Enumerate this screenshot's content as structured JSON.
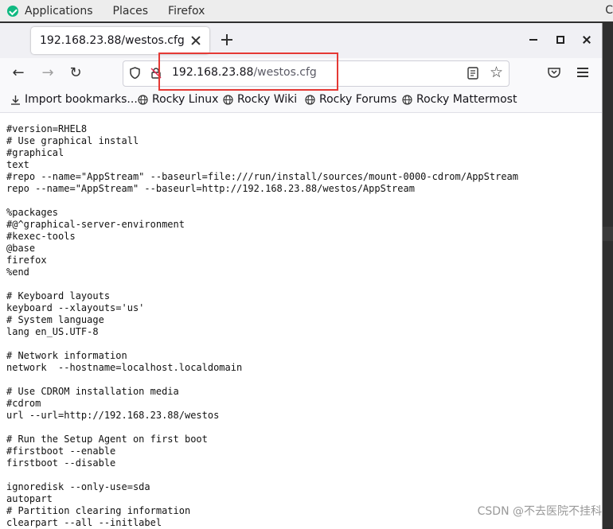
{
  "topbar": {
    "applications": "Applications",
    "places": "Places",
    "firefox": "Firefox",
    "clock_fragment": "C"
  },
  "tab": {
    "title": "192.168.23.88/westos.cfg"
  },
  "url": {
    "host": "192.168.23.88",
    "path": "/westos.cfg"
  },
  "bookmarks": [
    {
      "label": "Import bookmarks...",
      "icon": "import-icon"
    },
    {
      "label": "Rocky Linux",
      "icon": "globe-icon"
    },
    {
      "label": "Rocky Wiki",
      "icon": "globe-icon"
    },
    {
      "label": "Rocky Forums",
      "icon": "globe-icon"
    },
    {
      "label": "Rocky Mattermost",
      "icon": "globe-icon"
    }
  ],
  "file_text": "#version=RHEL8\n# Use graphical install\n#graphical\ntext\n#repo --name=\"AppStream\" --baseurl=file:///run/install/sources/mount-0000-cdrom/AppStream\nrepo --name=\"AppStream\" --baseurl=http://192.168.23.88/westos/AppStream\n\n%packages\n#@^graphical-server-environment\n#kexec-tools\n@base\nfirefox\n%end\n\n# Keyboard layouts\nkeyboard --xlayouts='us'\n# System language\nlang en_US.UTF-8\n\n# Network information\nnetwork  --hostname=localhost.localdomain\n\n# Use CDROM installation media\n#cdrom\nurl --url=http://192.168.23.88/westos\n\n# Run the Setup Agent on first boot\n#firstboot --enable\nfirstboot --disable\n\nignoredisk --only-use=sda\nautopart\n# Partition clearing information\nclearpart --all --initlabel",
  "watermark": "CSDN @不去医院不挂科",
  "colors": {
    "highlight": "#e53935",
    "rocky_green": "#10b981"
  }
}
